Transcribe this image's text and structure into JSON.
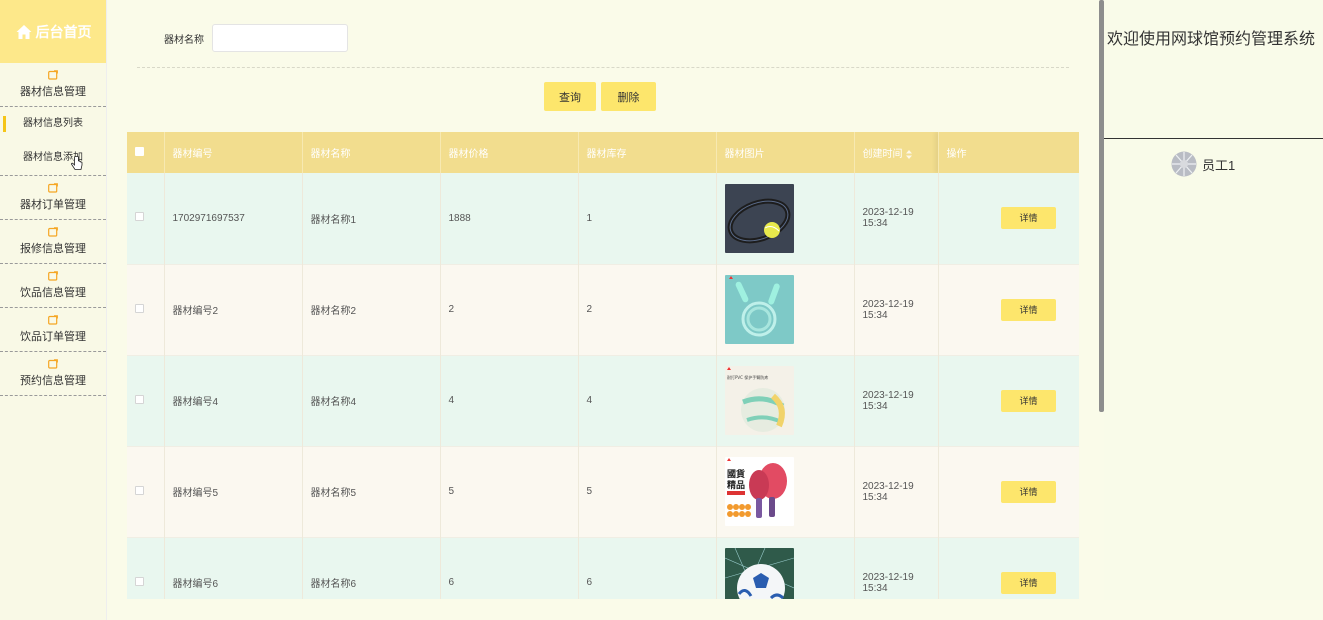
{
  "sidebar": {
    "brand": "后台首页",
    "groups": [
      {
        "label": "器材信息管理"
      },
      {
        "label": "器材订单管理"
      },
      {
        "label": "报修信息管理"
      },
      {
        "label": "饮品信息管理"
      },
      {
        "label": "饮品订单管理"
      },
      {
        "label": "预约信息管理"
      }
    ],
    "sub_items": [
      {
        "label": "器材信息列表",
        "active": true
      },
      {
        "label": "器材信息添加",
        "active": false
      }
    ]
  },
  "search": {
    "label": "器材名称",
    "value": "",
    "placeholder": ""
  },
  "buttons": {
    "query": "查询",
    "delete": "删除"
  },
  "table": {
    "columns": [
      "器材编号",
      "器材名称",
      "器材价格",
      "器材库存",
      "器材图片",
      "创建时间",
      "操作"
    ],
    "rows": [
      {
        "id": "1702971697537",
        "name": "器材名称1",
        "price": "1888",
        "stock": "1",
        "image": "tennis-racket-ball",
        "created": "2023-12-19 15:34",
        "action": "详情"
      },
      {
        "id": "器材编号2",
        "name": "器材名称2",
        "price": "2",
        "stock": "2",
        "image": "jump-rope",
        "created": "2023-12-19 15:34",
        "action": "详情"
      },
      {
        "id": "器材编号4",
        "name": "器材名称4",
        "price": "4",
        "stock": "4",
        "image": "volleyball",
        "created": "2023-12-19 15:34",
        "action": "详情"
      },
      {
        "id": "器材编号5",
        "name": "器材名称5",
        "price": "5",
        "stock": "5",
        "image": "ping-pong-paddles",
        "created": "2023-12-19 15:34",
        "action": "详情"
      },
      {
        "id": "器材编号6",
        "name": "器材名称6",
        "price": "6",
        "stock": "6",
        "image": "soccer-ball",
        "created": "2023-12-19 15:34",
        "action": "详情"
      }
    ],
    "image_texts": {
      "volleyball": "耐打PVC 保护手臂防疼",
      "paddle_line1": "國貨",
      "paddle_line2": "精品"
    }
  },
  "right_panel": {
    "welcome": "欢迎使用网球馆预约管理系统",
    "user_name": "员工1"
  },
  "colors": {
    "accent": "#fde66c",
    "brand_bg": "#fde88a",
    "header_bg": "#f2dd8e",
    "row_odd": "#e9f7ef",
    "row_even": "#fbf8f0"
  }
}
